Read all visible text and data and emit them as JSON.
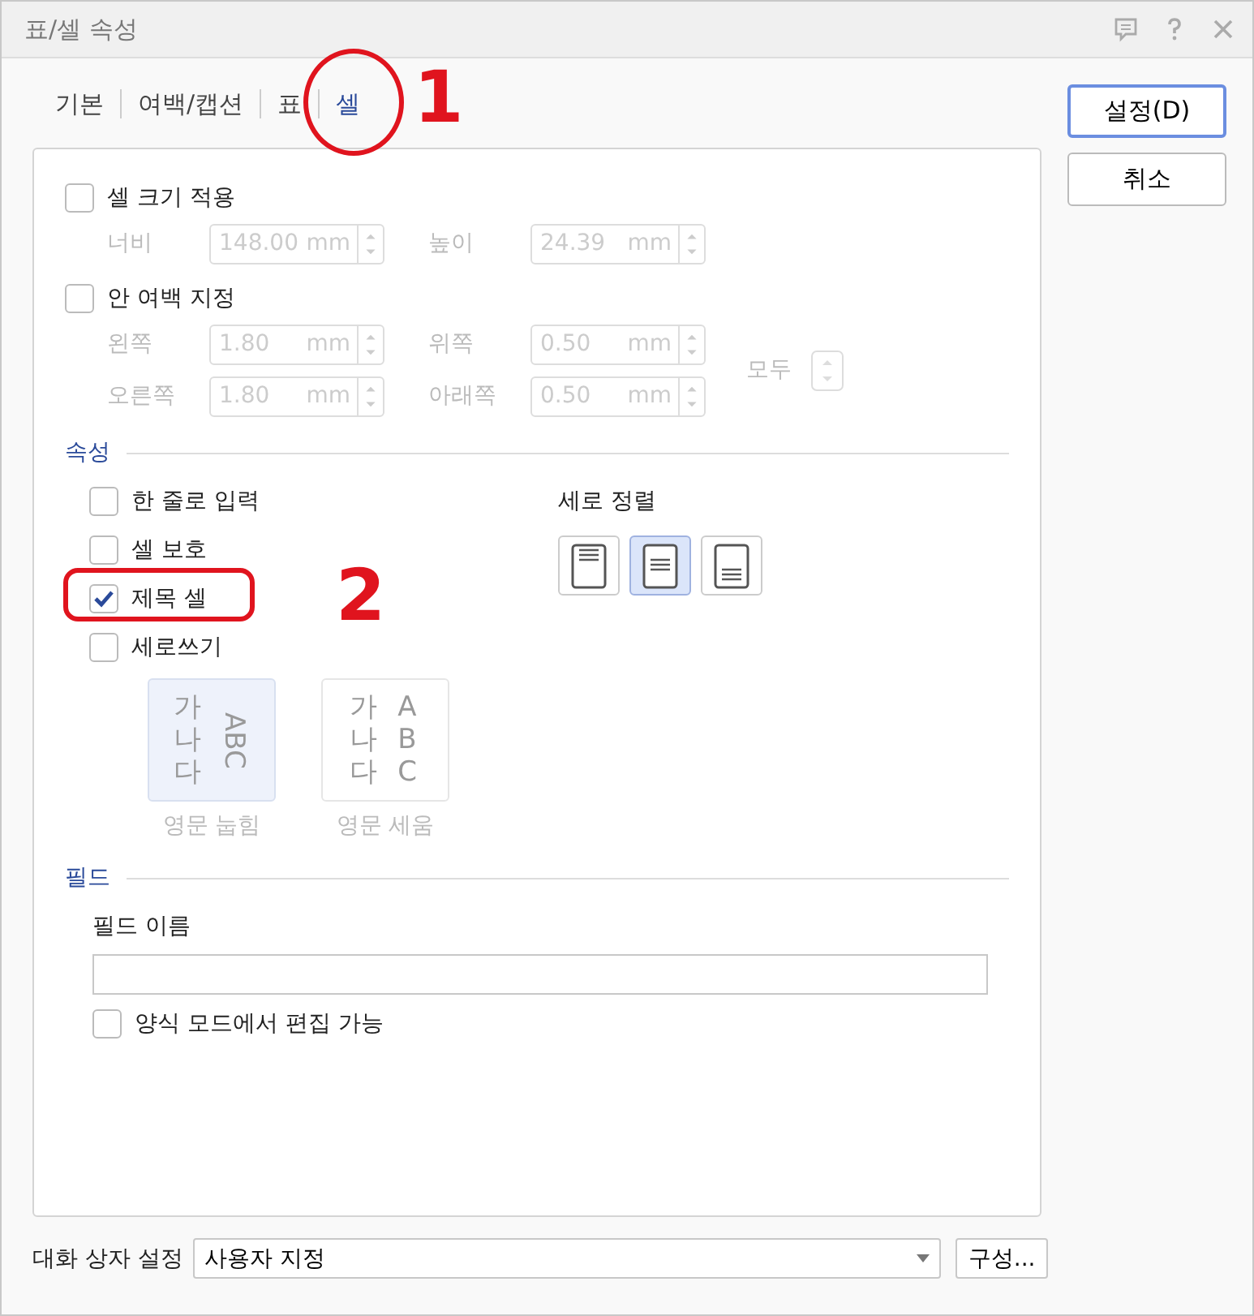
{
  "window": {
    "title": "표/셀 속성"
  },
  "tabs": [
    {
      "label": "기본",
      "selected": false
    },
    {
      "label": "여백/캡션",
      "selected": false
    },
    {
      "label": "표",
      "selected": false
    },
    {
      "label": "셀",
      "selected": true,
      "annotation": "1"
    }
  ],
  "cell_size": {
    "label": "셀 크기 적용",
    "checked": false,
    "disabled": true,
    "fields": [
      {
        "label": "너비",
        "value": "148.00",
        "unit": "mm"
      },
      {
        "label": "높이",
        "value": "24.39",
        "unit": "mm"
      }
    ]
  },
  "inner_margin": {
    "label": "안 여백 지정",
    "checked": false,
    "disabled": true,
    "fields": [
      {
        "label": "왼쪽",
        "value": "1.80",
        "unit": "mm"
      },
      {
        "label": "위쪽",
        "value": "0.50",
        "unit": "mm"
      },
      {
        "label": "오른쪽",
        "value": "1.80",
        "unit": "mm"
      },
      {
        "label": "아래쪽",
        "value": "0.50",
        "unit": "mm"
      }
    ],
    "all_label": "모두"
  },
  "properties": {
    "heading": "속성",
    "options": [
      {
        "label": "한 줄로 입력",
        "checked": false
      },
      {
        "label": "셀 보호",
        "checked": false
      },
      {
        "label": "제목 셀",
        "checked": true,
        "annotation": "2"
      },
      {
        "label": "세로쓰기",
        "checked": false
      }
    ],
    "text_direction": {
      "disabled": true,
      "options": [
        {
          "hangul": "가나다",
          "latin": "ABC",
          "label": "영문 눕힘",
          "rotated": true,
          "selected": true
        },
        {
          "hangul": "가나다",
          "latin": "ABC",
          "label": "영문 세움",
          "rotated": false,
          "selected": false
        }
      ]
    },
    "vertical_align": {
      "label": "세로 정렬",
      "options": [
        {
          "kind": "top",
          "selected": false
        },
        {
          "kind": "middle",
          "selected": true
        },
        {
          "kind": "bottom",
          "selected": false
        }
      ]
    }
  },
  "field": {
    "heading": "필드",
    "name_label": "필드 이름",
    "editable": {
      "label": "양식 모드에서 편집 가능",
      "checked": false
    }
  },
  "footer": {
    "label": "대화 상자 설정",
    "value": "사용자 지정",
    "button": "구성..."
  },
  "buttons": [
    {
      "label": "설정(D)",
      "default": true
    },
    {
      "label": "취소",
      "default": false
    }
  ]
}
